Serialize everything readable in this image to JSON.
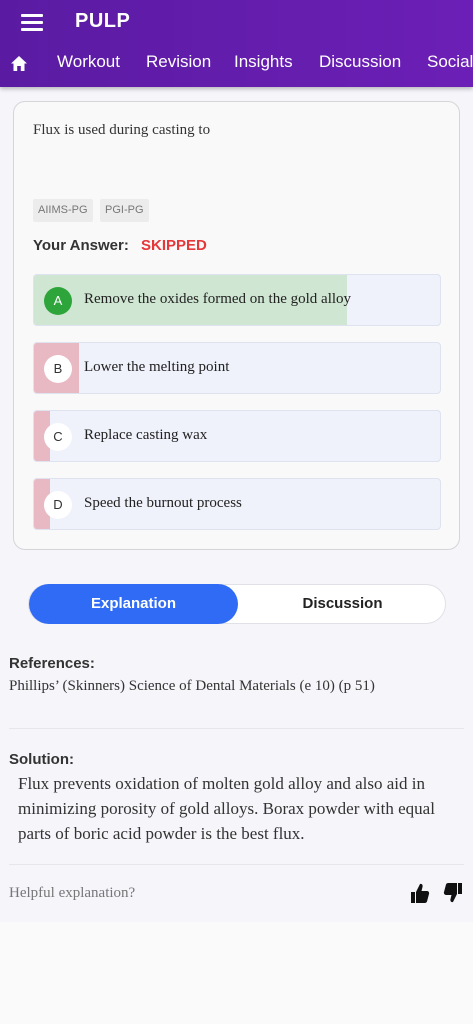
{
  "app": {
    "title": "PULP"
  },
  "nav": {
    "home_icon": "home-icon",
    "tabs": [
      "Workout",
      "Revision",
      "Insights",
      "Discussion",
      "Social"
    ]
  },
  "question": {
    "text": "Flux is used during casting to",
    "tags": [
      "AIIMS-PG",
      "PGI-PG"
    ],
    "your_answer_label": "Your Answer:",
    "your_answer_value": "SKIPPED",
    "options": [
      {
        "letter": "A",
        "text": "Remove the oxides formed on the gold alloy",
        "correct": true,
        "percent": 77
      },
      {
        "letter": "B",
        "text": "Lower the melting point",
        "correct": false,
        "percent": 11
      },
      {
        "letter": "C",
        "text": "Replace casting wax",
        "correct": false,
        "percent": 4
      },
      {
        "letter": "D",
        "text": "Speed the burnout process",
        "correct": false,
        "percent": 4
      }
    ]
  },
  "segmented": {
    "explanation": "Explanation",
    "discussion": "Discussion",
    "active": "Explanation"
  },
  "references": {
    "heading": "References:",
    "text": "Phillips’ (Skinners) Science of Dental Materials (e 10) (p 51)"
  },
  "solution": {
    "heading": "Solution:",
    "lines": [
      "Flux prevents oxidation of molten gold alloy and also aid in",
      "minimizing porosity of gold alloys. Borax powder with equal",
      "parts of boric acid powder is the best flux."
    ]
  },
  "feedback": {
    "prompt": "Helpful explanation?",
    "up_icon": "thumbs-up-icon",
    "down_icon": "thumbs-down-icon"
  },
  "colors": {
    "primary": "#5a1ba2",
    "accent": "#2f6bf5",
    "correct": "#2ea53a",
    "wrong": "#e5383b"
  }
}
